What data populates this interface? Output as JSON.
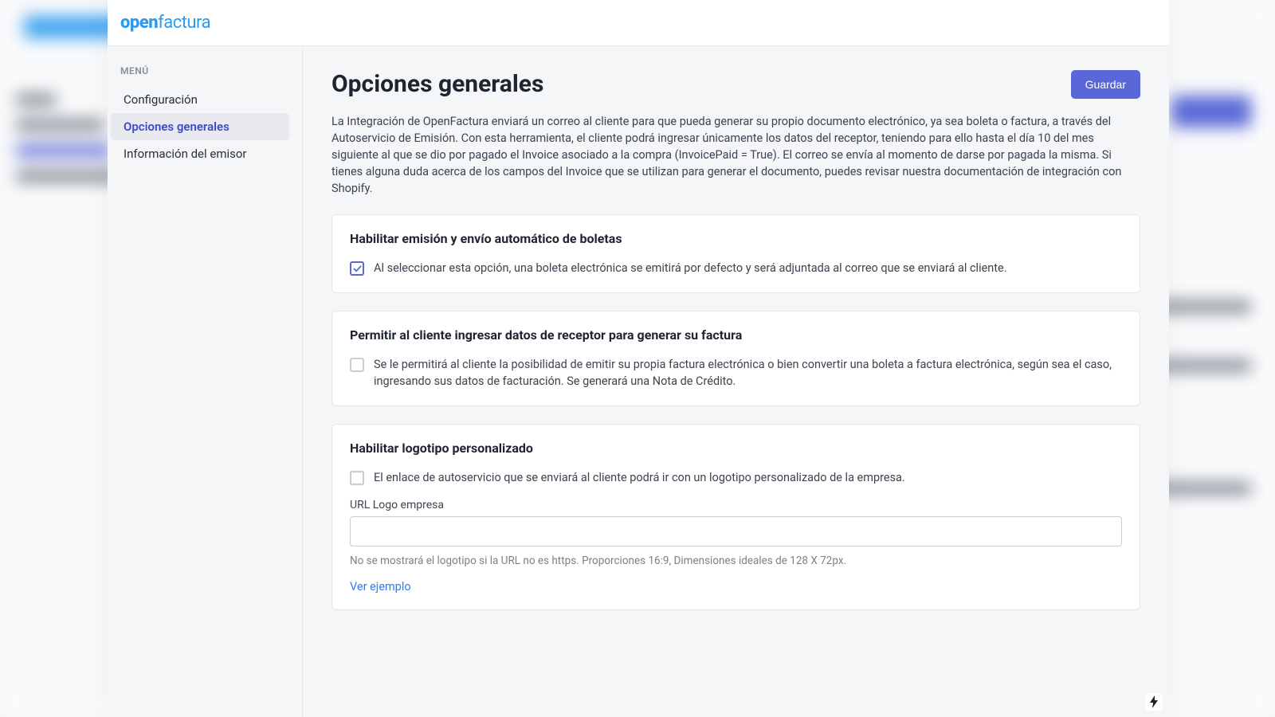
{
  "brand": {
    "prefix": "open",
    "suffix": "factura"
  },
  "sidebar": {
    "menu_label": "MENÚ",
    "items": [
      {
        "label": "Configuración"
      },
      {
        "label": "Opciones generales"
      },
      {
        "label": "Información del emisor"
      }
    ]
  },
  "page": {
    "title": "Opciones generales",
    "save_label": "Guardar",
    "intro": "La Integración de OpenFactura enviará un correo al cliente para que pueda generar su propio documento electrónico, ya sea boleta o factura, a través del Autoservicio de Emisión. Con esta herramienta, el cliente podrá ingresar únicamente los datos del receptor, teniendo para ello hasta el día 10 del mes siguiente al que se dio por pagado el Invoice asociado a la compra (InvoicePaid = True). El correo se envía al momento de darse por pagada la misma. Si tienes alguna duda acerca de los campos del Invoice que se utilizan para generar el documento, puedes revisar nuestra documentación de integración con Shopify."
  },
  "cards": {
    "auto_boletas": {
      "title": "Habilitar emisión y envío automático de boletas",
      "desc": "Al seleccionar esta opción, una boleta electrónica se emitirá por defecto y será adjuntada al correo que se enviará al cliente."
    },
    "receptor": {
      "title": "Permitir al cliente ingresar datos de receptor para generar su factura",
      "desc": "Se le permitirá al cliente la posibilidad de emitir su propia factura electrónica o bien convertir una boleta a factura electrónica, según sea el caso, ingresando sus datos de facturación. Se generará una Nota de Crédito."
    },
    "logo": {
      "title": "Habilitar logotipo personalizado",
      "desc": "El enlace de autoservicio que se enviará al cliente podrá ir con un logotipo personalizado de la empresa.",
      "url_label": "URL Logo empresa",
      "helper": "No se mostrará el logotipo si la URL no es https. Proporciones 16:9, Dimensiones ideales de 128 X 72px.",
      "example_link": "Ver ejemplo"
    }
  }
}
